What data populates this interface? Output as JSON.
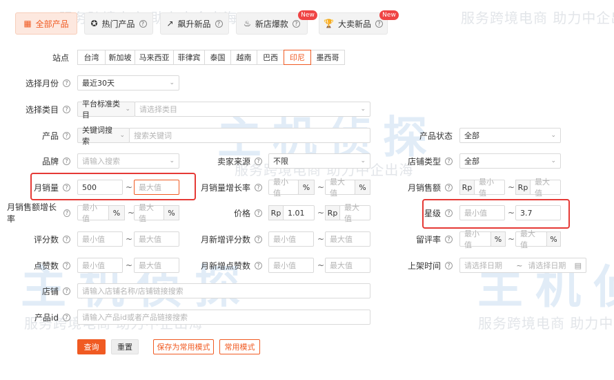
{
  "tabs": [
    {
      "label": "全部产品",
      "active": true
    },
    {
      "label": "热门产品"
    },
    {
      "label": "飙升新品"
    },
    {
      "label": "新店爆款",
      "badge": "New"
    },
    {
      "label": "大卖新品",
      "badge": "New"
    }
  ],
  "sites": {
    "label": "站点",
    "options": [
      "台湾",
      "新加坡",
      "马来西亚",
      "菲律宾",
      "泰国",
      "越南",
      "巴西",
      "印尼",
      "墨西哥"
    ],
    "selected": "印尼"
  },
  "month": {
    "label": "选择月份",
    "value": "最近30天"
  },
  "category": {
    "label": "选择类目",
    "type_value": "平台标准类目",
    "placeholder": "请选择类目"
  },
  "product": {
    "label": "产品",
    "type_value": "关键词搜索",
    "placeholder": "搜索关键词"
  },
  "product_status": {
    "label": "产品状态",
    "value": "全部"
  },
  "brand": {
    "label": "品牌",
    "placeholder": "请输入搜索"
  },
  "seller_source": {
    "label": "卖家来源",
    "value": "不限"
  },
  "shop_type": {
    "label": "店铺类型",
    "value": "全部"
  },
  "monthly_sales": {
    "label": "月销量",
    "min": "500",
    "max_placeholder": "最大值"
  },
  "monthly_sales_growth": {
    "label": "月销量增长率",
    "min_placeholder": "最小值",
    "max_placeholder": "最大值",
    "unit": "%"
  },
  "monthly_revenue": {
    "label": "月销售额",
    "prefix": "Rp",
    "min_placeholder": "最小值",
    "max_placeholder": "最大值"
  },
  "monthly_revenue_growth": {
    "label": "月销售额增长率",
    "min_placeholder": "最小值",
    "max_placeholder": "最大值",
    "unit": "%"
  },
  "price": {
    "label": "价格",
    "prefix": "Rp",
    "min": "1.01",
    "max_placeholder": "最大值"
  },
  "rating": {
    "label": "星级",
    "min_placeholder": "最小值",
    "max": "3.7"
  },
  "reviews": {
    "label": "评分数",
    "min_placeholder": "最小值",
    "max_placeholder": "最大值"
  },
  "new_reviews": {
    "label": "月新增评分数",
    "min_placeholder": "最小值",
    "max_placeholder": "最大值"
  },
  "retention": {
    "label": "留评率",
    "min_placeholder": "最小值",
    "max_placeholder": "最大值",
    "unit": "%"
  },
  "likes": {
    "label": "点赞数",
    "min_placeholder": "最小值",
    "max_placeholder": "最大值"
  },
  "new_likes": {
    "label": "月新增点赞数",
    "min_placeholder": "最小值",
    "max_placeholder": "最大值"
  },
  "listed_time": {
    "label": "上架时间",
    "start_placeholder": "请选择日期",
    "end_placeholder": "请选择日期"
  },
  "shop": {
    "label": "店铺",
    "placeholder": "请输入店铺名称/店铺链接搜索"
  },
  "product_id": {
    "label": "产品id",
    "placeholder": "请输入产品id或者产品链接搜索"
  },
  "buttons": {
    "query": "查询",
    "reset": "重置",
    "save_mode": "保存为常用模式",
    "common_mode": "常用模式"
  },
  "watermark": {
    "text": "服务跨境电商 助力中企出海",
    "brand": "主机侦探"
  },
  "colors": {
    "accent": "#f05a22",
    "highlight_frame": "#e53935",
    "badge": "#ef4444"
  }
}
